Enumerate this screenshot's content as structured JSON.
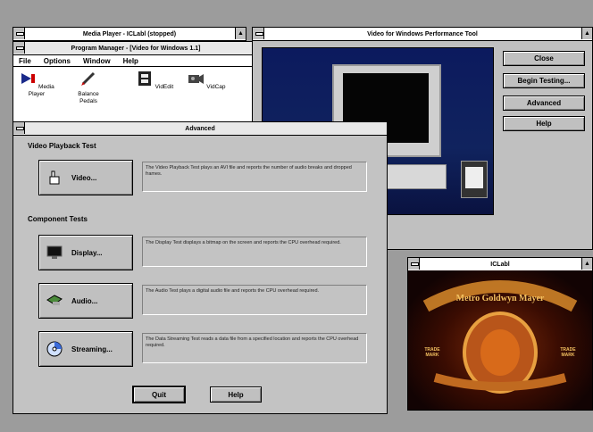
{
  "media_player": {
    "title": "Media Player - ICLabl (stopped)"
  },
  "program_manager": {
    "title": "Program Manager - [Video for Windows 1.1]",
    "menu": [
      "File",
      "Options",
      "Window",
      "Help"
    ],
    "icons": [
      {
        "label": "Media Player",
        "icon": "media-player-icon"
      },
      {
        "label": "Balance Pedals",
        "icon": "pencil-icon"
      },
      {
        "label": "VidEdit",
        "icon": "film-icon"
      },
      {
        "label": "VidCap",
        "icon": "camera-icon"
      }
    ]
  },
  "perf_tool": {
    "title": "Video for Windows Performance Tool",
    "buttons": [
      "Close",
      "Begin Testing...",
      "Advanced",
      "Help"
    ]
  },
  "advanced_dialog": {
    "title": "Advanced",
    "video_section": "Video Playback Test",
    "component_section": "Component Tests",
    "tests": [
      {
        "button": "Video...",
        "icon": "hand-pointer-icon",
        "desc": "The Video Playback Test plays an AVI file and reports the number of audio breaks and dropped frames."
      },
      {
        "button": "Display...",
        "icon": "monitor-icon",
        "desc": "The Display Test displays a bitmap on the screen and reports the CPU overhead required."
      },
      {
        "button": "Audio...",
        "icon": "speaker-icon",
        "desc": "The Audio Test plays a digital audio file and reports the CPU overhead required."
      },
      {
        "button": "Streaming...",
        "icon": "disc-icon",
        "desc": "The Data Streaming Test reads a data file from a specified location and reports the CPU overhead required."
      }
    ],
    "quit": "Quit",
    "help": "Help"
  },
  "clip_window": {
    "title": "ICLabl",
    "logo_text": "Metro Goldwyn Mayer",
    "left_text": "TRADE MARK",
    "right_text": "TRADE MARK"
  },
  "colors": {
    "desktop": "#9c9c9c",
    "video_bg": "#0f1b5c",
    "clip_bg": "#120303"
  }
}
